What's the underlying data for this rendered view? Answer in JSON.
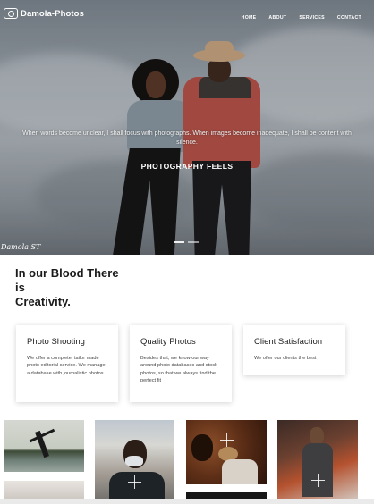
{
  "brand": {
    "name": "Damola-Photos",
    "logo_icon": "camera-icon"
  },
  "nav": {
    "items": [
      "HOME",
      "ABOUT",
      "SERVICES",
      "CONTACT"
    ]
  },
  "hero": {
    "caption": "When words become unclear, I shall focus with photographs. When images become inadequate, I shall be content with silence.",
    "title": "PHOTOGRAPHY FEELS",
    "signature": "Damola ST",
    "slides": 2,
    "active_slide": 1
  },
  "about": {
    "title_line1": "In our Blood There",
    "title_line2": "is",
    "title_line3": "Creativity."
  },
  "features": [
    {
      "title": "Photo Shooting",
      "text": "We offer a complete, tailor made photo editorial service. We manage a database with journalistic photos"
    },
    {
      "title": "Quality Photos",
      "text": "Besides that, we know our way around photo databases and stock photos, so that we always find the perfect fit"
    },
    {
      "title": "Client Satisfaction",
      "text": "We offer our clients the best"
    }
  ],
  "gallery": {
    "icon": "plus-icon"
  },
  "colors": {
    "text": "#222222",
    "hero_text": "#ffffff",
    "card_shadow": "#cccccc"
  }
}
